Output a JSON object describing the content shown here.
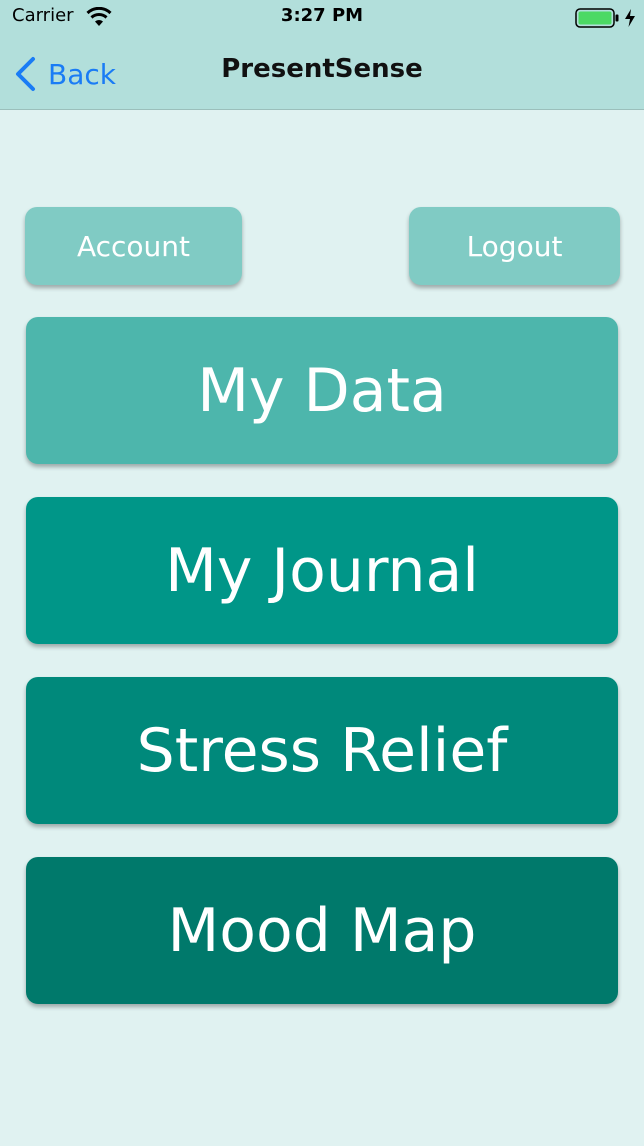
{
  "status_bar": {
    "carrier": "Carrier",
    "time": "3:27 PM"
  },
  "nav": {
    "back_label": "Back",
    "title": "PresentSense"
  },
  "buttons": {
    "account": "Account",
    "logout": "Logout",
    "my_data": "My Data",
    "my_journal": "My Journal",
    "stress_relief": "Stress Relief",
    "mood_map": "Mood Map"
  },
  "colors": {
    "nav_background": "#b2dfdb",
    "page_background": "#e0f2f1",
    "small_button": "#80cbc4",
    "my_data": "#4db6ac",
    "my_journal": "#009688",
    "stress_relief": "#00897b",
    "mood_map": "#00796b",
    "back_tint": "#1a7cf5"
  }
}
